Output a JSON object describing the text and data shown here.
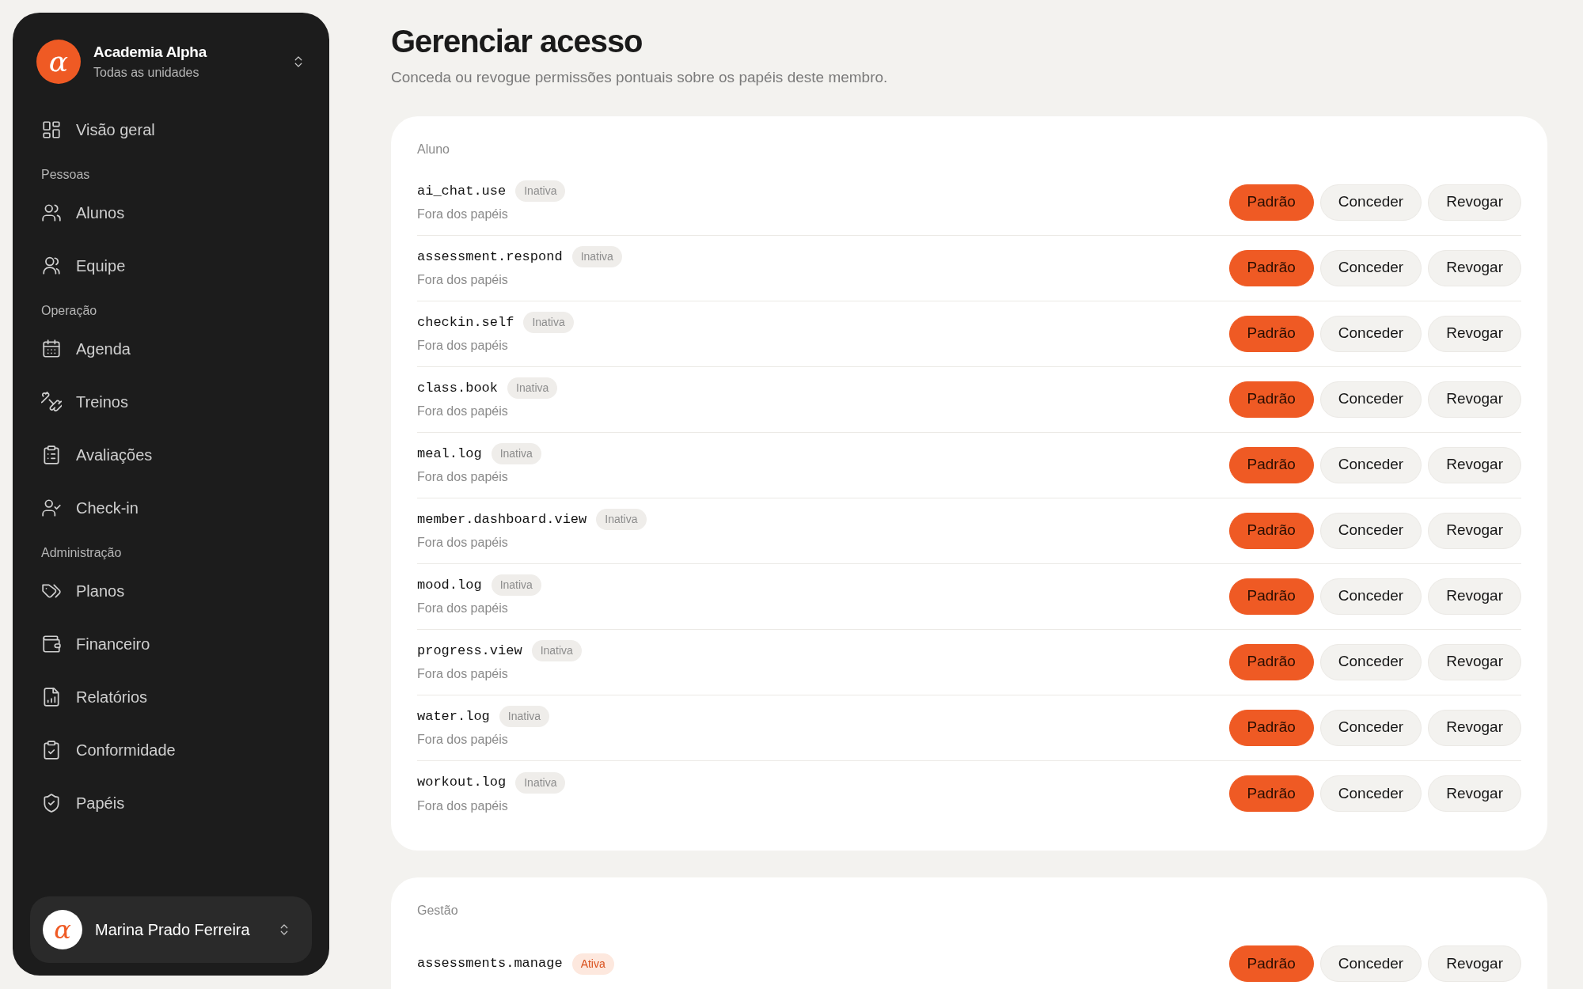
{
  "org": {
    "logo": "α",
    "name": "Academia Alpha",
    "subtitle": "Todas as unidades"
  },
  "nav": [
    {
      "kind": "item",
      "label": "Visão geral"
    },
    {
      "kind": "section",
      "label": "Pessoas"
    },
    {
      "kind": "item",
      "label": "Alunos"
    },
    {
      "kind": "item",
      "label": "Equipe"
    },
    {
      "kind": "section",
      "label": "Operação"
    },
    {
      "kind": "item",
      "label": "Agenda"
    },
    {
      "kind": "item",
      "label": "Treinos"
    },
    {
      "kind": "item",
      "label": "Avaliações"
    },
    {
      "kind": "item",
      "label": "Check-in"
    },
    {
      "kind": "section",
      "label": "Administração"
    },
    {
      "kind": "item",
      "label": "Planos"
    },
    {
      "kind": "item",
      "label": "Financeiro"
    },
    {
      "kind": "item",
      "label": "Relatórios"
    },
    {
      "kind": "item",
      "label": "Conformidade"
    },
    {
      "kind": "item",
      "label": "Papéis"
    }
  ],
  "user": {
    "logo": "α",
    "name": "Marina Prado Ferreira"
  },
  "page": {
    "title": "Gerenciar acesso",
    "subtitle": "Conceda ou revogue permissões pontuais sobre os papéis deste membro."
  },
  "groups": [
    {
      "title": "Aluno",
      "permissions": [
        {
          "code": "ai_chat.use",
          "active": false,
          "status": "Inativa",
          "note": "Fora dos papéis",
          "options": [
            {
              "label": "Padrão",
              "selected": true
            },
            {
              "label": "Conceder",
              "selected": false
            },
            {
              "label": "Revogar",
              "selected": false
            }
          ]
        },
        {
          "code": "assessment.respond",
          "active": false,
          "status": "Inativa",
          "note": "Fora dos papéis",
          "options": [
            {
              "label": "Padrão",
              "selected": true
            },
            {
              "label": "Conceder",
              "selected": false
            },
            {
              "label": "Revogar",
              "selected": false
            }
          ]
        },
        {
          "code": "checkin.self",
          "active": false,
          "status": "Inativa",
          "note": "Fora dos papéis",
          "options": [
            {
              "label": "Padrão",
              "selected": true
            },
            {
              "label": "Conceder",
              "selected": false
            },
            {
              "label": "Revogar",
              "selected": false
            }
          ]
        },
        {
          "code": "class.book",
          "active": false,
          "status": "Inativa",
          "note": "Fora dos papéis",
          "options": [
            {
              "label": "Padrão",
              "selected": true
            },
            {
              "label": "Conceder",
              "selected": false
            },
            {
              "label": "Revogar",
              "selected": false
            }
          ]
        },
        {
          "code": "meal.log",
          "active": false,
          "status": "Inativa",
          "note": "Fora dos papéis",
          "options": [
            {
              "label": "Padrão",
              "selected": true
            },
            {
              "label": "Conceder",
              "selected": false
            },
            {
              "label": "Revogar",
              "selected": false
            }
          ]
        },
        {
          "code": "member.dashboard.view",
          "active": false,
          "status": "Inativa",
          "note": "Fora dos papéis",
          "options": [
            {
              "label": "Padrão",
              "selected": true
            },
            {
              "label": "Conceder",
              "selected": false
            },
            {
              "label": "Revogar",
              "selected": false
            }
          ]
        },
        {
          "code": "mood.log",
          "active": false,
          "status": "Inativa",
          "note": "Fora dos papéis",
          "options": [
            {
              "label": "Padrão",
              "selected": true
            },
            {
              "label": "Conceder",
              "selected": false
            },
            {
              "label": "Revogar",
              "selected": false
            }
          ]
        },
        {
          "code": "progress.view",
          "active": false,
          "status": "Inativa",
          "note": "Fora dos papéis",
          "options": [
            {
              "label": "Padrão",
              "selected": true
            },
            {
              "label": "Conceder",
              "selected": false
            },
            {
              "label": "Revogar",
              "selected": false
            }
          ]
        },
        {
          "code": "water.log",
          "active": false,
          "status": "Inativa",
          "note": "Fora dos papéis",
          "options": [
            {
              "label": "Padrão",
              "selected": true
            },
            {
              "label": "Conceder",
              "selected": false
            },
            {
              "label": "Revogar",
              "selected": false
            }
          ]
        },
        {
          "code": "workout.log",
          "active": false,
          "status": "Inativa",
          "note": "Fora dos papéis",
          "options": [
            {
              "label": "Padrão",
              "selected": true
            },
            {
              "label": "Conceder",
              "selected": false
            },
            {
              "label": "Revogar",
              "selected": false
            }
          ]
        }
      ]
    },
    {
      "title": "Gestão",
      "permissions": [
        {
          "code": "assessments.manage",
          "active": true,
          "status": "Ativa",
          "options": [
            {
              "label": "Padrão",
              "selected": true
            },
            {
              "label": "Conceder",
              "selected": false
            },
            {
              "label": "Revogar",
              "selected": false
            }
          ]
        }
      ]
    }
  ]
}
